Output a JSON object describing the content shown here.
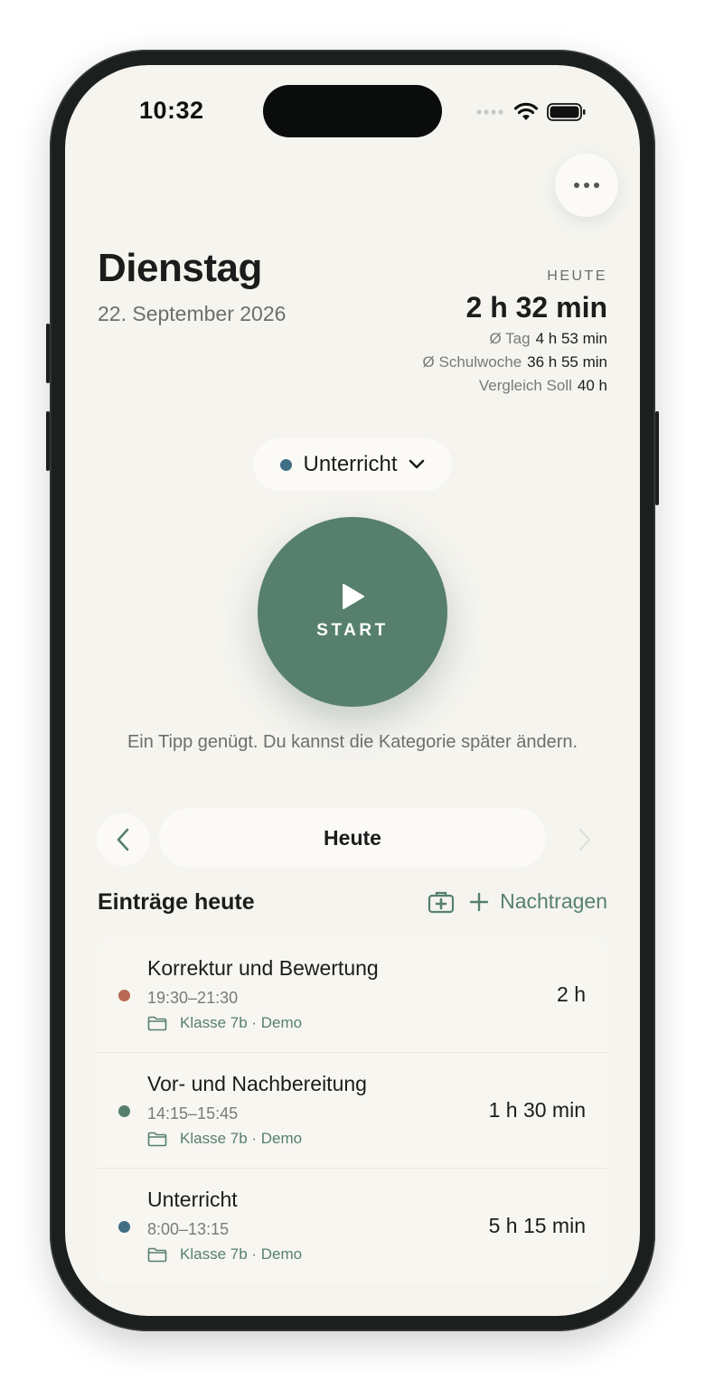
{
  "status_bar": {
    "time": "10:32"
  },
  "header": {
    "day": "Dienstag",
    "date": "22. September 2026"
  },
  "stats": {
    "label": "HEUTE",
    "total": "2 h 32 min",
    "rows": [
      {
        "label": "Ø Tag",
        "value": "4 h 53 min"
      },
      {
        "label": "Ø Schulwoche",
        "value": "36 h 55 min"
      },
      {
        "label": "Vergleich Soll",
        "value": "40 h"
      }
    ]
  },
  "category": {
    "label": "Unterricht",
    "color": "#3f6e85"
  },
  "start_button": {
    "label": "START",
    "color": "#56806d"
  },
  "hint": "Ein Tipp genügt. Du kannst die Kategorie später ändern.",
  "day_nav": {
    "label": "Heute"
  },
  "entries_section": {
    "title": "Einträge heute",
    "add_label": "Nachtragen"
  },
  "entries": [
    {
      "title": "Korrektur und Bewertung",
      "time": "19:30–21:30",
      "meta": "Klasse 7b · Demo",
      "duration": "2 h",
      "color": "#b86a54"
    },
    {
      "title": "Vor- und Nachbereitung",
      "time": "14:15–15:45",
      "meta": "Klasse 7b · Demo",
      "duration": "1 h 30 min",
      "color": "#56806d"
    },
    {
      "title": "Unterricht",
      "time": "8:00–13:15",
      "meta": "Klasse 7b · Demo",
      "duration": "5 h 15 min",
      "color": "#3f6e85"
    }
  ]
}
